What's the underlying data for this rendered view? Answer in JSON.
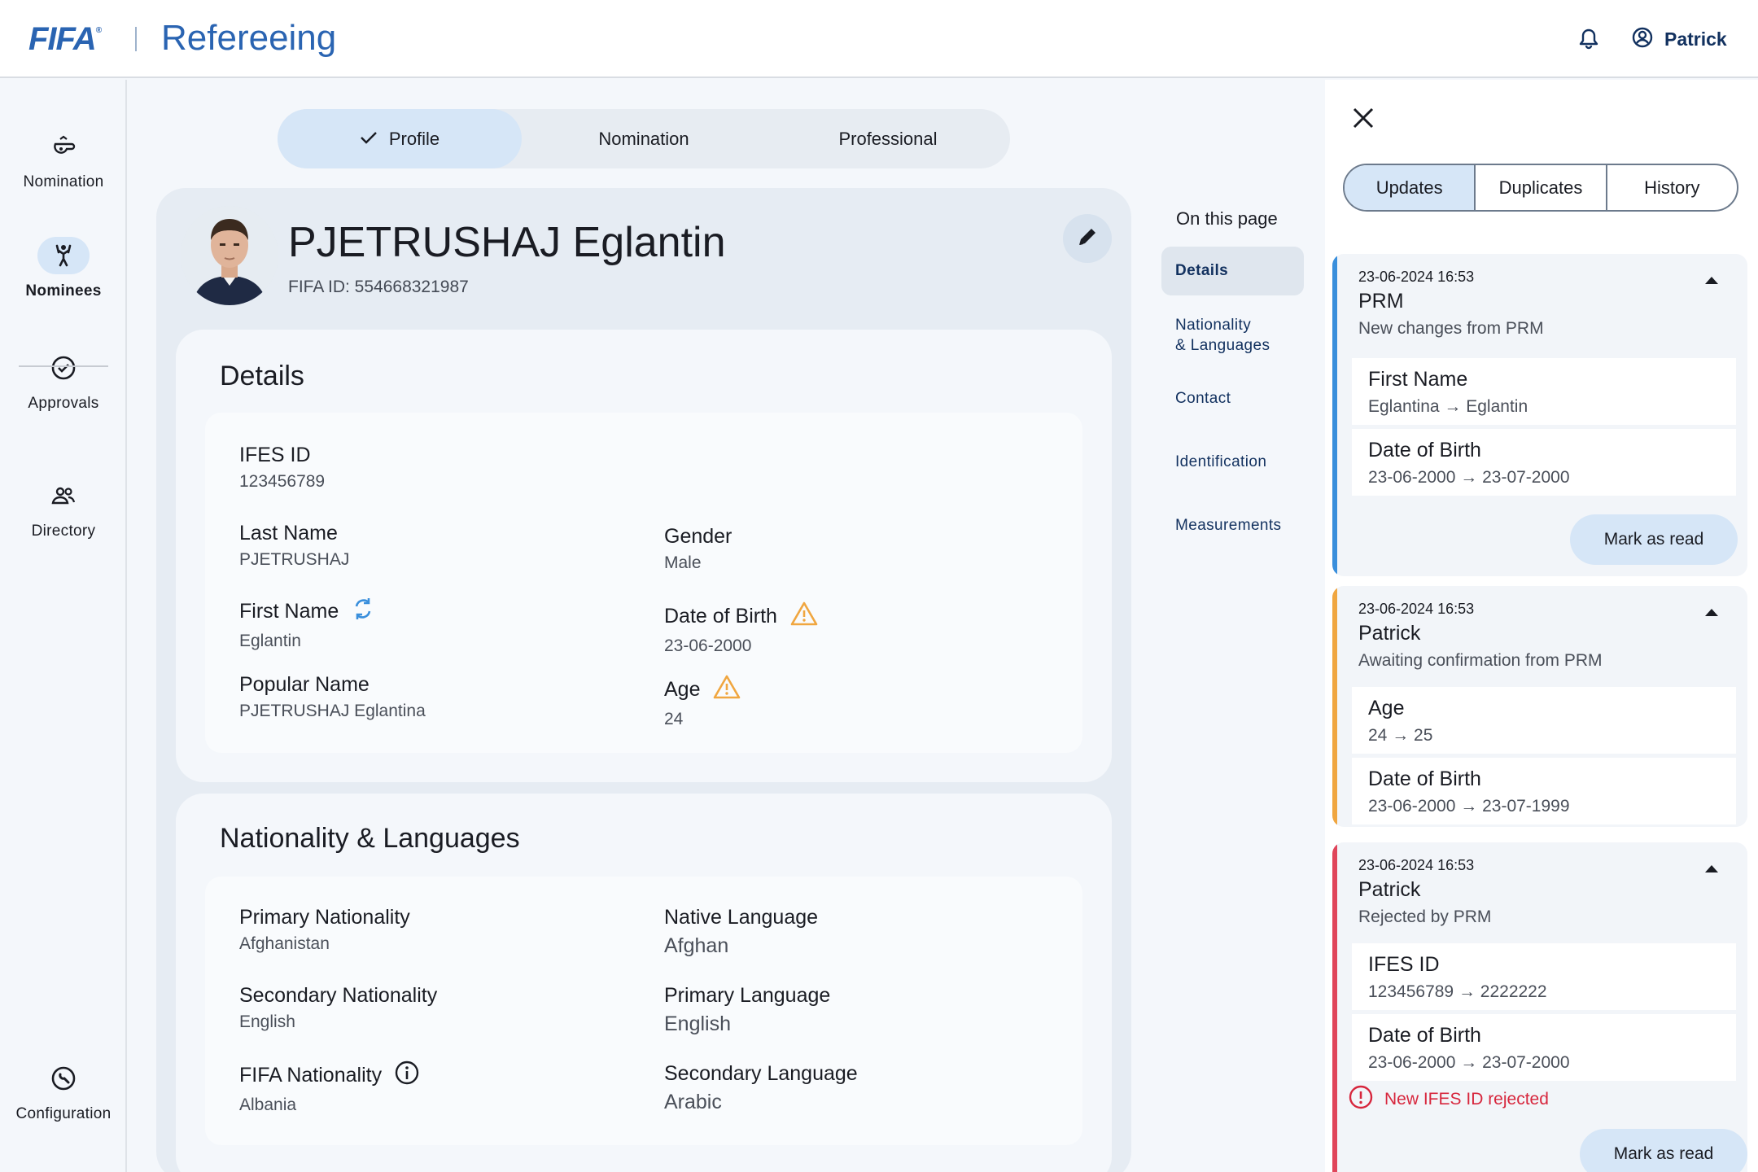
{
  "header": {
    "logo_text": "FIFA",
    "logo_mark": "®",
    "app_title": "Refereeing",
    "user_name": "Patrick",
    "bell_icon": "bell-icon",
    "user_icon": "user-circle-icon"
  },
  "rail": {
    "items": [
      {
        "label": "Nomination",
        "icon": "whistle-icon"
      },
      {
        "label": "Nominees",
        "icon": "referee-icon"
      },
      {
        "label": "Approvals",
        "icon": "check-circle-icon"
      },
      {
        "label": "Directory",
        "icon": "people-icon"
      },
      {
        "label": "Configuration",
        "icon": "wrench-circle-icon"
      }
    ]
  },
  "tabs": [
    {
      "label": "Profile",
      "active": true
    },
    {
      "label": "Nomination",
      "active": false
    },
    {
      "label": "Professional",
      "active": false
    }
  ],
  "profile": {
    "name": "PJETRUSHAJ Eglantin",
    "fifa_id": "FIFA ID: 554668321987"
  },
  "details": {
    "title": "Details",
    "ifes_id_label": "IFES ID",
    "ifes_id_value": "123456789",
    "last_name_label": "Last Name",
    "last_name_value": "PJETRUSHAJ",
    "first_name_label": "First Name",
    "first_name_value": "Eglantin",
    "popular_name_label": "Popular Name",
    "popular_name_value": "PJETRUSHAJ Eglantina",
    "gender_label": "Gender",
    "gender_value": "Male",
    "dob_label": "Date of Birth",
    "dob_value": "23-06-2000",
    "age_label": "Age",
    "age_value": "24"
  },
  "nationality": {
    "title": "Nationality & Languages",
    "primary_nat_label": "Primary Nationality",
    "primary_nat_value": "Afghanistan",
    "secondary_nat_label": "Secondary Nationality",
    "secondary_nat_value": "English",
    "fifa_nat_label": "FIFA Nationality",
    "fifa_nat_value": "Albania",
    "native_lang_label": "Native Language",
    "native_lang_value": "Afghan",
    "primary_lang_label": "Primary Language",
    "primary_lang_value": "English",
    "secondary_lang_label": "Secondary Language",
    "secondary_lang_value": "Arabic"
  },
  "on_this_page": {
    "title": "On this page",
    "items": [
      "Details",
      "Nationality",
      "& Languages",
      "Contact",
      "Identification",
      "Measurements"
    ]
  },
  "panel": {
    "segments": [
      "Updates",
      "Duplicates",
      "History"
    ],
    "colors": {
      "prm": "#3a8fdc",
      "pending": "#f0a640",
      "rejected": "#e0455a"
    },
    "updates": [
      {
        "timestamp": "23-06-2024 16:53",
        "author": "PRM",
        "note": "New changes from PRM",
        "changes": [
          {
            "label": "First Name",
            "value": "Eglantina → Eglantin"
          },
          {
            "label": "Date of Birth",
            "value": "23-06-2000 → 23-07-2000"
          }
        ],
        "action": "Mark as read"
      },
      {
        "timestamp": "23-06-2024 16:53",
        "author": "Patrick",
        "note": "Awaiting confirmation from PRM",
        "changes": [
          {
            "label": "Age",
            "value": "24 → 25"
          },
          {
            "label": "Date of Birth",
            "value": "23-06-2000 → 23-07-1999"
          }
        ]
      },
      {
        "timestamp": "23-06-2024 16:53",
        "author": "Patrick",
        "note": "Rejected by PRM",
        "changes": [
          {
            "label": "IFES ID",
            "value": "123456789 → 2222222"
          },
          {
            "label": "Date of Birth",
            "value": "23-06-2000 → 23-07-2000"
          }
        ],
        "error": "New IFES ID rejected",
        "action": "Mark as read"
      }
    ]
  }
}
